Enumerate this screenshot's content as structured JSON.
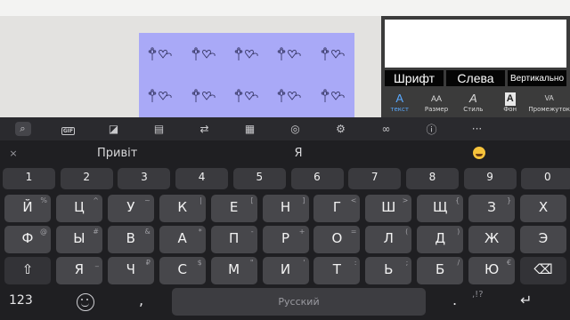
{
  "panel": {
    "options": [
      "Шрифт",
      "Слева",
      "Вертикально"
    ],
    "tools": [
      {
        "icon": "A",
        "label": "текст",
        "active": true
      },
      {
        "icon": "AA",
        "label": "Размер",
        "active": false
      },
      {
        "icon": "A",
        "label": "Стиль",
        "active": false
      },
      {
        "icon": "A",
        "label": "Фон",
        "active": false
      },
      {
        "icon": "VA",
        "label": "Промежуток",
        "active": false
      }
    ]
  },
  "keyboard": {
    "toolbar": [
      "search",
      "gif",
      "sticker",
      "clipboard",
      "translate",
      "calendar",
      "palette",
      "settings",
      "glasses",
      "info",
      "more"
    ],
    "suggestions": {
      "close": "×",
      "items": [
        "Привіт",
        "Я",
        ""
      ]
    },
    "numbers": [
      "1",
      "2",
      "3",
      "4",
      "5",
      "6",
      "7",
      "8",
      "9",
      "0"
    ],
    "row1": [
      {
        "m": "Й",
        "h": "%"
      },
      {
        "m": "Ц",
        "h": "^"
      },
      {
        "m": "У",
        "h": "~"
      },
      {
        "m": "К",
        "h": "|"
      },
      {
        "m": "Е",
        "h": "["
      },
      {
        "m": "Н",
        "h": "]"
      },
      {
        "m": "Г",
        "h": "<"
      },
      {
        "m": "Ш",
        "h": ">"
      },
      {
        "m": "Щ",
        "h": "{"
      },
      {
        "m": "З",
        "h": "}"
      },
      {
        "m": "Х",
        "h": ""
      }
    ],
    "row2": [
      {
        "m": "Ф",
        "h": "@"
      },
      {
        "m": "Ы",
        "h": "#"
      },
      {
        "m": "В",
        "h": "&"
      },
      {
        "m": "А",
        "h": "*"
      },
      {
        "m": "П",
        "h": "-"
      },
      {
        "m": "Р",
        "h": "+"
      },
      {
        "m": "О",
        "h": "="
      },
      {
        "m": "Л",
        "h": "("
      },
      {
        "m": "Д",
        "h": ")"
      },
      {
        "m": "Ж",
        "h": ""
      },
      {
        "m": "Э",
        "h": ""
      }
    ],
    "row3": [
      {
        "m": "⇧",
        "h": ""
      },
      {
        "m": "Я",
        "h": "_"
      },
      {
        "m": "Ч",
        "h": "₽"
      },
      {
        "m": "С",
        "h": "$"
      },
      {
        "m": "М",
        "h": "\""
      },
      {
        "m": "И",
        "h": "'"
      },
      {
        "m": "Т",
        "h": ":"
      },
      {
        "m": "Ь",
        "h": ";"
      },
      {
        "m": "Б",
        "h": "/"
      },
      {
        "m": "Ю",
        "h": "€"
      },
      {
        "m": "⌫",
        "h": ""
      }
    ],
    "bottom": {
      "numbers": "123",
      "comma": ",",
      "space": "Русский",
      "period": ".",
      "punct": ",!?",
      "enter": "↵"
    }
  }
}
